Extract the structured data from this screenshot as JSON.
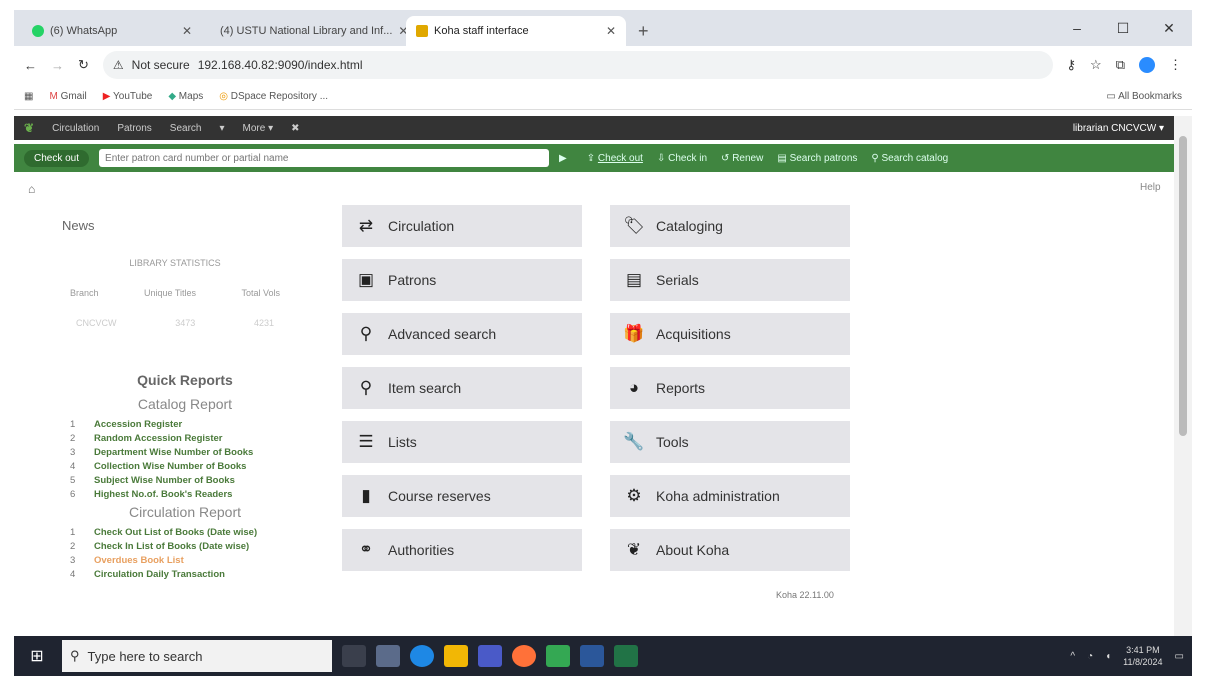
{
  "browser": {
    "tabs": [
      {
        "label": "(6) WhatsApp",
        "active": false,
        "color": "#25d366"
      },
      {
        "label": "(4) USTU National Library and Inf...",
        "active": false,
        "color": "#888888"
      },
      {
        "label": "Koha staff interface",
        "active": true,
        "color": "#e0a800"
      }
    ],
    "new_tab": "+",
    "window_controls": [
      "–",
      "☐",
      "✕"
    ],
    "security": "Not secure",
    "url": "192.168.40.82:9090/index.html",
    "bookmarks": [
      "Gmail",
      "YouTube",
      "Maps",
      "DSpace Repository ..."
    ],
    "all_bookmarks": "All Bookmarks"
  },
  "koha": {
    "nav": [
      "Circulation",
      "Patrons",
      "Search",
      "More"
    ],
    "user": "librarian CNCVCW",
    "checkout_button": "Check out",
    "patron_placeholder": "Enter patron card number or partial name",
    "quick_links": [
      "Check out",
      "Check in",
      "Renew",
      "Search patrons",
      "Search catalog"
    ],
    "help": "Help",
    "news": "News",
    "stats": {
      "title": "LIBRARY STATISTICS",
      "headers": [
        "Branch",
        "Unique Titles",
        "Total Vols"
      ],
      "row": [
        "CNCVCW",
        "3473",
        "4231"
      ]
    },
    "quick_reports": {
      "title": "Quick Reports",
      "catalog_title": "Catalog Report",
      "catalog_items": [
        "Accession Register",
        "Random Accession Register",
        "Department Wise Number of Books",
        "Collection Wise Number of Books",
        "Subject Wise Number of Books",
        "Highest No.of. Book's Readers"
      ],
      "circ_title": "Circulation Report",
      "circ_items": [
        "Check Out List of Books (Date wise)",
        "Check In List of Books (Date wise)",
        "Overdues Book List",
        "Circulation Daily Transaction"
      ]
    },
    "modules": [
      {
        "label": "Circulation",
        "icon": "exchange-icon"
      },
      {
        "label": "Cataloging",
        "icon": "tag-icon"
      },
      {
        "label": "Patrons",
        "icon": "id-card-icon"
      },
      {
        "label": "Serials",
        "icon": "newspaper-icon"
      },
      {
        "label": "Advanced search",
        "icon": "search-icon"
      },
      {
        "label": "Acquisitions",
        "icon": "gift-icon"
      },
      {
        "label": "Item search",
        "icon": "search-icon"
      },
      {
        "label": "Reports",
        "icon": "pie-chart-icon"
      },
      {
        "label": "Lists",
        "icon": "list-icon"
      },
      {
        "label": "Tools",
        "icon": "wrench-icon"
      },
      {
        "label": "Course reserves",
        "icon": "book-icon"
      },
      {
        "label": "Koha administration",
        "icon": "cogs-icon"
      },
      {
        "label": "Authorities",
        "icon": "link-icon"
      },
      {
        "label": "About Koha",
        "icon": "koha-icon"
      }
    ],
    "version": "Koha 22.11.00"
  },
  "taskbar": {
    "search_placeholder": "Type here to search",
    "time": "3:41 PM",
    "date": "11/8/2024"
  }
}
